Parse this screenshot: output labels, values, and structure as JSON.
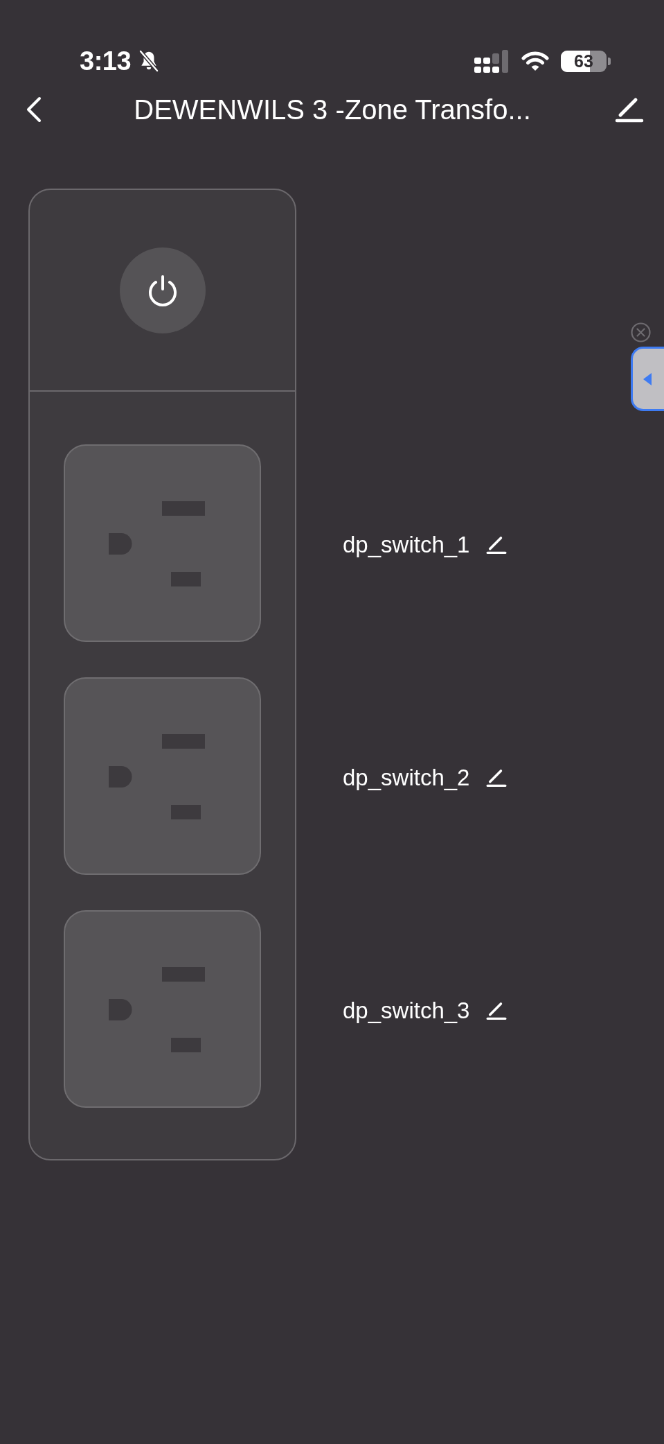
{
  "status_bar": {
    "time": "3:13",
    "battery": "63"
  },
  "header": {
    "title": "DEWENWILS 3 -Zone Transfo..."
  },
  "power_strip": {
    "master_power": {
      "on": false
    },
    "outlets": [
      {
        "name": "dp_switch_1",
        "on": false
      },
      {
        "name": "dp_switch_2",
        "on": false
      },
      {
        "name": "dp_switch_3",
        "on": false
      }
    ]
  }
}
